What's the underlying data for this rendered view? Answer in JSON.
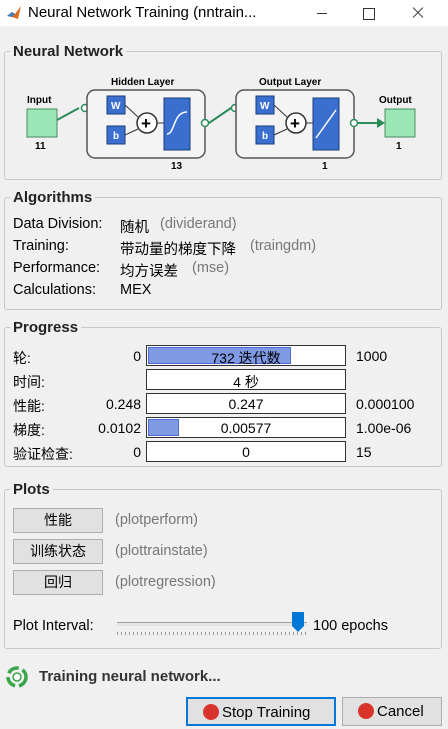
{
  "window": {
    "title": "Neural Network Training (nntrain..."
  },
  "network": {
    "section_title": "Neural Network",
    "input_label": "Input",
    "input_size": "11",
    "hidden_title": "Hidden Layer",
    "hidden_size": "13",
    "output_title": "Output Layer",
    "output_size": "1",
    "output_label": "Output",
    "output_count": "1",
    "w_label": "W",
    "b_label": "b",
    "plus": "+",
    "colors": {
      "node": "#9be6b4",
      "layer_bg": "#f4f4f4",
      "block": "#3a6fd0",
      "wire": "#2b8c5a"
    }
  },
  "algorithms": {
    "section_title": "Algorithms",
    "rows": [
      {
        "label": "Data Division:",
        "value": "随机",
        "code": "(dividerand)"
      },
      {
        "label": "Training:",
        "value": "带动量的梯度下降",
        "code": "(traingdm)"
      },
      {
        "label": "Performance:",
        "value": "均方误差",
        "code": "(mse)"
      },
      {
        "label": "Calculations:",
        "value": "MEX",
        "code": ""
      }
    ]
  },
  "progress": {
    "section_title": "Progress",
    "rows": [
      {
        "label": "轮:",
        "start": "0",
        "text": "732 迭代数",
        "end": "1000",
        "fill": 0.732
      },
      {
        "label": "时间:",
        "start": "",
        "text": "4 秒",
        "end": "",
        "fill": 0
      },
      {
        "label": "性能:",
        "start": "0.248",
        "text": "0.247",
        "end": "0.000100",
        "fill": 0
      },
      {
        "label": "梯度:",
        "start": "0.0102",
        "text": "0.00577",
        "end": "1.00e-06",
        "fill": 0.16
      },
      {
        "label": "验证检查:",
        "start": "0",
        "text": "0",
        "end": "15",
        "fill": 0
      }
    ]
  },
  "plots": {
    "section_title": "Plots",
    "buttons": [
      {
        "label": "性能",
        "code": "(plotperform)"
      },
      {
        "label": "训练状态",
        "code": "(plottrainstate)"
      },
      {
        "label": "回归",
        "code": "(plotregression)"
      }
    ],
    "interval_label": "Plot Interval:",
    "interval_value": "100 epochs",
    "interval_level": 0.92
  },
  "status": {
    "text": "Training neural network..."
  },
  "buttons": {
    "stop": "Stop Training",
    "cancel": "Cancel"
  }
}
